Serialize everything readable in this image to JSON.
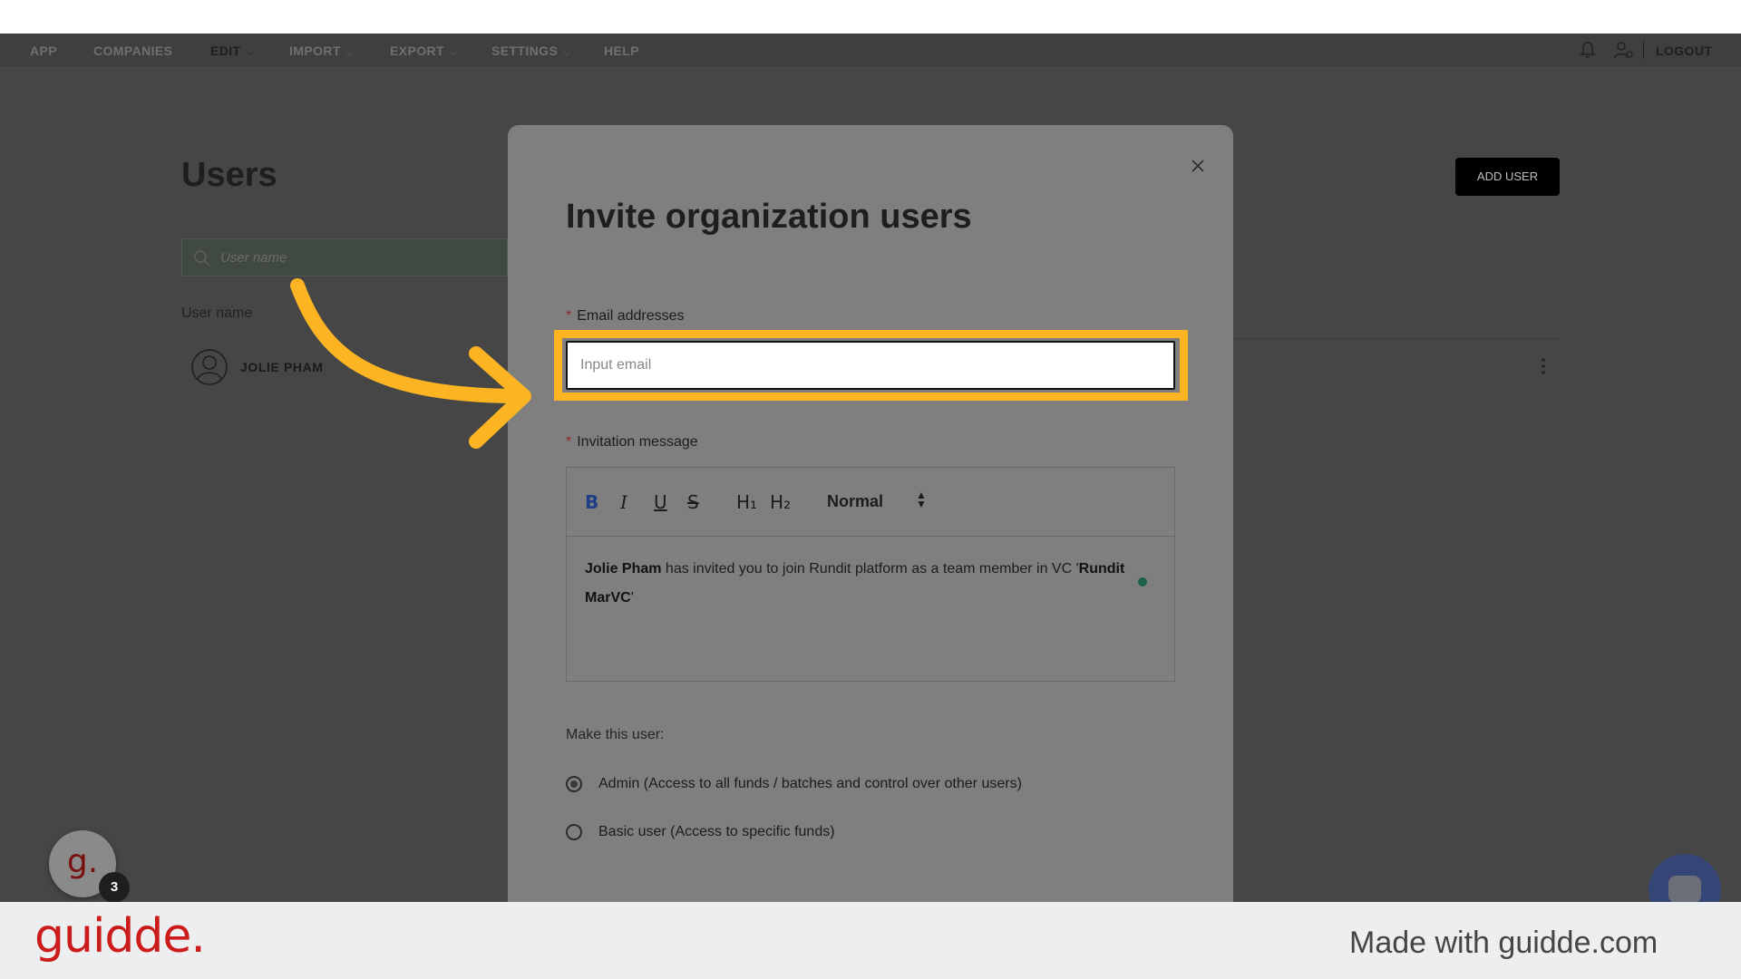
{
  "nav": {
    "items": [
      {
        "label": "APP"
      },
      {
        "label": "COMPANIES"
      },
      {
        "label": "EDIT"
      },
      {
        "label": "IMPORT"
      },
      {
        "label": "EXPORT"
      },
      {
        "label": "SETTINGS"
      },
      {
        "label": "HELP"
      }
    ],
    "logout_label": "LOGOUT"
  },
  "page": {
    "title": "Users",
    "add_user_label": "ADD USER",
    "search_placeholder": "User name",
    "column_header": "User name",
    "users": [
      {
        "name": "JOLIE PHAM"
      }
    ]
  },
  "modal": {
    "title": "Invite organization users",
    "required_mark": "*",
    "email_label": "Email addresses",
    "email_placeholder": "Input email",
    "message_label": "Invitation message",
    "toolbar": {
      "bold": "B",
      "italic": "I",
      "underline": "U",
      "strike": "S",
      "h1": "H₁",
      "h2": "H₂",
      "format_value": "Normal"
    },
    "message": {
      "inviter": "Jolie Pham",
      "text": " has invited you to join Rundit platform as a team member in VC '",
      "org": "Rundit MarVC",
      "end": "'"
    },
    "make_label": "Make this user:",
    "roles": [
      {
        "label": "Admin (Access to all funds / batches and control over other users)",
        "selected": true
      },
      {
        "label": "Basic user (Access to specific funds)",
        "selected": false
      }
    ]
  },
  "overlay": {
    "guidde_badge_count": "3",
    "guidde_fab_letter": "g."
  },
  "footer": {
    "logo": "guidde.",
    "made_with": "Made with guidde.com"
  },
  "colors": {
    "highlight": "#fcb423",
    "brand_red": "#cc1b1b"
  }
}
